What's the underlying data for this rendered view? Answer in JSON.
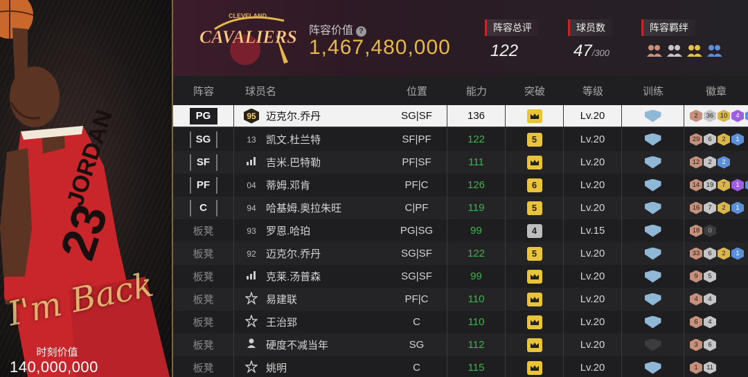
{
  "card": {
    "signature": "I'm Back",
    "value_label": "时刻价值",
    "value": "140,000,000"
  },
  "header": {
    "team_logo_text": "CAVALIERS",
    "team_logo_city": "CLEVELAND",
    "lineup_value_label": "阵容价值",
    "lineup_value": "1,467,480,000",
    "overall_label": "阵容总评",
    "overall_value": "122",
    "player_count_label": "球员数",
    "player_count": "47",
    "player_count_max": "/300",
    "bond_label": "阵容羁绊",
    "bond_icons": [
      "bond-bronze-icon",
      "bond-silver-icon",
      "bond-gold-icon",
      "bond-blue-icon"
    ]
  },
  "table": {
    "headers": [
      "阵容",
      "球员名",
      "位置",
      "能力",
      "突破",
      "等级",
      "训练",
      "徽章"
    ],
    "rows": [
      {
        "slot": "PG",
        "rating": "95",
        "name": "迈克尔.乔丹",
        "position": "SG|SF",
        "ability": "136",
        "breakthrough": "",
        "level": "Lv.20",
        "badges": [
          [
            "2",
            "bronze"
          ],
          [
            "36",
            "silver"
          ],
          [
            "10",
            "gold"
          ],
          [
            "4",
            "purple"
          ],
          [
            "",
            "blue"
          ]
        ]
      },
      {
        "slot": "SG",
        "rating": "13",
        "name": "凯文.杜兰特",
        "position": "SF|PF",
        "ability": "122",
        "breakthrough": "5",
        "level": "Lv.20",
        "badges": [
          [
            "29",
            "bronze"
          ],
          [
            "6",
            "silver"
          ],
          [
            "2",
            "gold"
          ],
          [
            "1",
            "blue"
          ]
        ]
      },
      {
        "slot": "SF",
        "rating": "",
        "name": "吉米.巴特勒",
        "position": "PF|SF",
        "ability": "111",
        "breakthrough": "",
        "level": "Lv.20",
        "badges": [
          [
            "12",
            "bronze"
          ],
          [
            "2",
            "silver"
          ],
          [
            "2",
            "blue"
          ]
        ]
      },
      {
        "slot": "PF",
        "rating": "04",
        "name": "蒂姆.邓肯",
        "position": "PF|C",
        "ability": "126",
        "breakthrough": "6",
        "level": "Lv.20",
        "badges": [
          [
            "14",
            "bronze"
          ],
          [
            "19",
            "silver"
          ],
          [
            "7",
            "gold"
          ],
          [
            "1",
            "purple"
          ],
          [
            "",
            "blue"
          ]
        ]
      },
      {
        "slot": "C",
        "rating": "94",
        "name": "哈基姆.奥拉朱旺",
        "position": "C|PF",
        "ability": "119",
        "breakthrough": "5",
        "level": "Lv.20",
        "badges": [
          [
            "16",
            "bronze"
          ],
          [
            "7",
            "silver"
          ],
          [
            "2",
            "gold"
          ],
          [
            "1",
            "blue"
          ]
        ]
      },
      {
        "slot": "板凳",
        "rating": "93",
        "name": "罗恩.哈珀",
        "position": "PG|SG",
        "ability": "99",
        "breakthrough": "4",
        "level": "Lv.15",
        "badges": [
          [
            "18",
            "bronze"
          ],
          [
            "0",
            "dark"
          ]
        ]
      },
      {
        "slot": "板凳",
        "rating": "92",
        "name": "迈克尔.乔丹",
        "position": "SG|SF",
        "ability": "122",
        "breakthrough": "5",
        "level": "Lv.20",
        "badges": [
          [
            "33",
            "bronze"
          ],
          [
            "6",
            "silver"
          ],
          [
            "2",
            "gold"
          ],
          [
            "1",
            "blue"
          ]
        ]
      },
      {
        "slot": "板凳",
        "rating": "",
        "name": "克莱.汤普森",
        "position": "SG|SF",
        "ability": "99",
        "breakthrough": "",
        "level": "Lv.20",
        "badges": [
          [
            "9",
            "bronze"
          ],
          [
            "5",
            "silver"
          ]
        ]
      },
      {
        "slot": "板凳",
        "rating": "",
        "name": "易建联",
        "position": "PF|C",
        "ability": "110",
        "breakthrough": "",
        "level": "Lv.20",
        "badges": [
          [
            "4",
            "bronze"
          ],
          [
            "4",
            "silver"
          ]
        ]
      },
      {
        "slot": "板凳",
        "rating": "",
        "name": "王治郅",
        "position": "C",
        "ability": "110",
        "breakthrough": "",
        "level": "Lv.20",
        "badges": [
          [
            "6",
            "bronze"
          ],
          [
            "4",
            "silver"
          ]
        ]
      },
      {
        "slot": "板凳",
        "rating": "",
        "name": "硬度不减当年",
        "position": "SG",
        "ability": "112",
        "breakthrough": "",
        "level": "Lv.20",
        "badges": [
          [
            "3",
            "bronze"
          ],
          [
            "6",
            "silver"
          ]
        ]
      },
      {
        "slot": "板凳",
        "rating": "",
        "name": "姚明",
        "position": "C",
        "ability": "115",
        "breakthrough": "",
        "level": "Lv.20",
        "badges": [
          [
            "1",
            "bronze"
          ],
          [
            "11",
            "silver"
          ]
        ]
      }
    ]
  },
  "icons": {
    "rating_signal": "signal-bars-icon",
    "rating_star": "star-icon",
    "rating_person": "person-icon",
    "breakthrough": "crown-icon",
    "training": "shield-icon"
  }
}
